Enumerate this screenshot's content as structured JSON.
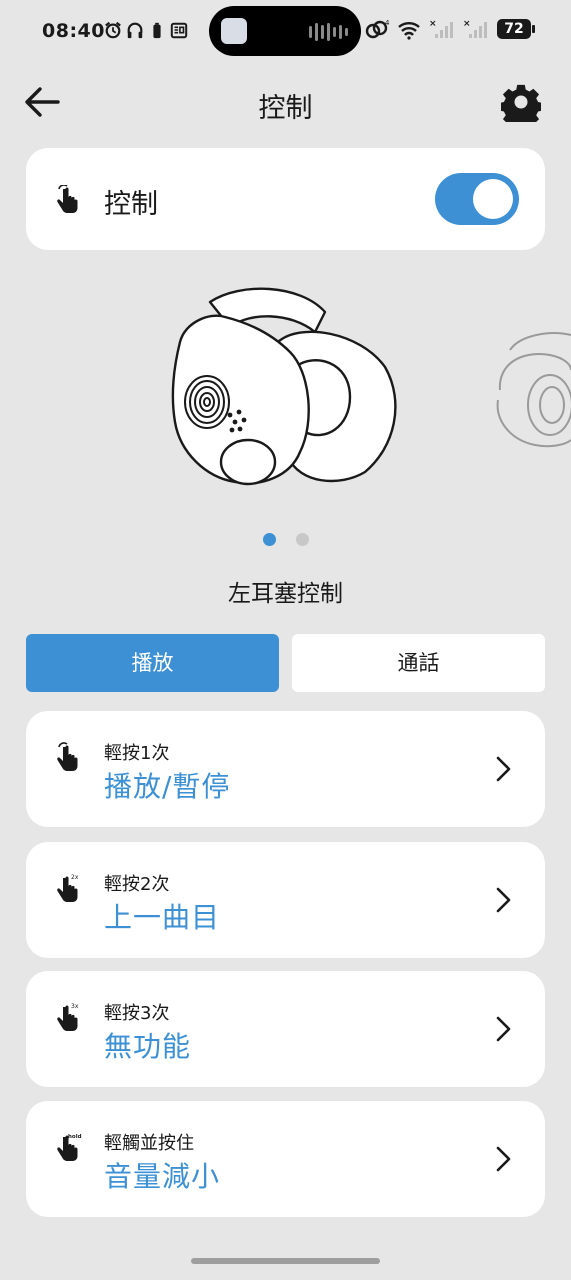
{
  "status_bar": {
    "time": "08:40",
    "battery": "72"
  },
  "header": {
    "title": "控制"
  },
  "control": {
    "label": "控制",
    "enabled": true
  },
  "carousel": {
    "pages": 2,
    "active_page": 1,
    "section_title": "左耳塞控制"
  },
  "tabs": [
    {
      "label": "播放",
      "active": true
    },
    {
      "label": "通話",
      "active": false
    }
  ],
  "actions": [
    {
      "gesture": "輕按1次",
      "value": "播放/暫停",
      "icon": "tap-hand-icon",
      "badge": ""
    },
    {
      "gesture": "輕按2次",
      "value": "上一曲目",
      "icon": "double-tap-hand-icon",
      "badge": "2x"
    },
    {
      "gesture": "輕按3次",
      "value": "無功能",
      "icon": "triple-tap-hand-icon",
      "badge": "3x"
    },
    {
      "gesture": "輕觸並按住",
      "value": "音量減小",
      "icon": "hold-hand-icon",
      "badge": "hold"
    }
  ],
  "colors": {
    "accent": "#3d90d4",
    "background": "#e6e6e6",
    "card": "#ffffff"
  }
}
